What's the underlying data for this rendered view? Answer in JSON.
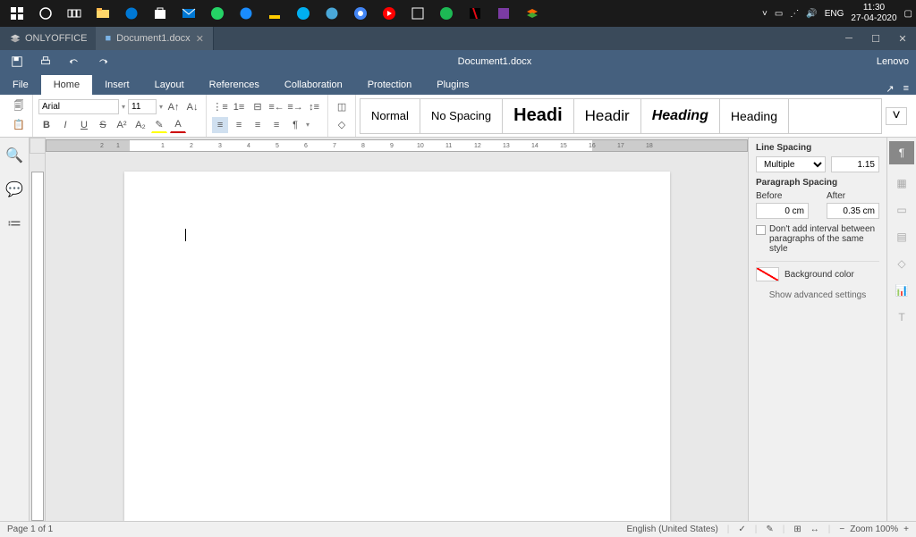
{
  "taskbar": {
    "time": "11:30",
    "date": "27-04-2020",
    "lang": "ENG"
  },
  "titlebar": {
    "app": "ONLYOFFICE",
    "tab": "Document1.docx"
  },
  "qat": {
    "title": "Document1.docx",
    "user": "Lenovo"
  },
  "menu": {
    "file": "File",
    "home": "Home",
    "insert": "Insert",
    "layout": "Layout",
    "references": "References",
    "collaboration": "Collaboration",
    "protection": "Protection",
    "plugins": "Plugins"
  },
  "toolbar": {
    "font": "Arial",
    "size": "11",
    "bold": "B",
    "italic": "I",
    "underline": "U",
    "strike": "S",
    "super": "A²",
    "sub": "A₂"
  },
  "styles": {
    "normal": "Normal",
    "nospacing": "No Spacing",
    "h1": "Headi",
    "h2": "Headir",
    "h3": "Heading",
    "h4": "Heading"
  },
  "panel": {
    "linespacing_title": "Line Spacing",
    "linespacing_mode": "Multiple",
    "linespacing_value": "1.15",
    "paraspacing_title": "Paragraph Spacing",
    "before_label": "Before",
    "after_label": "After",
    "before_value": "0 cm",
    "after_value": "0.35 cm",
    "checkbox_text": "Don't add interval between paragraphs of the same style",
    "bgcolor_label": "Background color",
    "advanced": "Show advanced settings"
  },
  "statusbar": {
    "page": "Page 1 of 1",
    "lang": "English (United States)",
    "zoom": "Zoom 100%"
  }
}
